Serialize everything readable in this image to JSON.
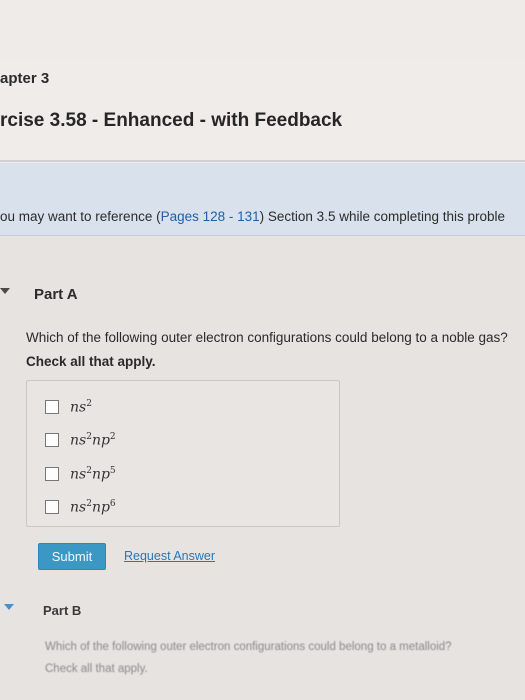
{
  "header": {
    "chapter": "apter 3",
    "exercise_title": "rcise 3.58 - Enhanced - with Feedback"
  },
  "info": {
    "prefix": "ou may want to reference (",
    "link": "Pages 128 - 131",
    "suffix": ") Section 3.5 while completing this proble"
  },
  "part_a": {
    "title": "Part A",
    "question": "Which of the following outer electron configurations could belong to a noble gas?",
    "instruction": "Check all that apply.",
    "options": [
      {
        "base": "ns",
        "sup": "2",
        "base2": "",
        "sup2": ""
      },
      {
        "base": "ns",
        "sup": "2",
        "base2": "np",
        "sup2": "2"
      },
      {
        "base": "ns",
        "sup": "2",
        "base2": "np",
        "sup2": "5"
      },
      {
        "base": "ns",
        "sup": "2",
        "base2": "np",
        "sup2": "6"
      }
    ],
    "submit_label": "Submit",
    "request_label": "Request Answer"
  },
  "part_b": {
    "title": "Part B",
    "question": "Which of the following outer electron configurations could belong to a metalloid?",
    "instruction": "Check all that apply."
  },
  "colors": {
    "accent": "#3b97c4",
    "link": "#2a76b6",
    "banner": "#d9e2ec"
  }
}
